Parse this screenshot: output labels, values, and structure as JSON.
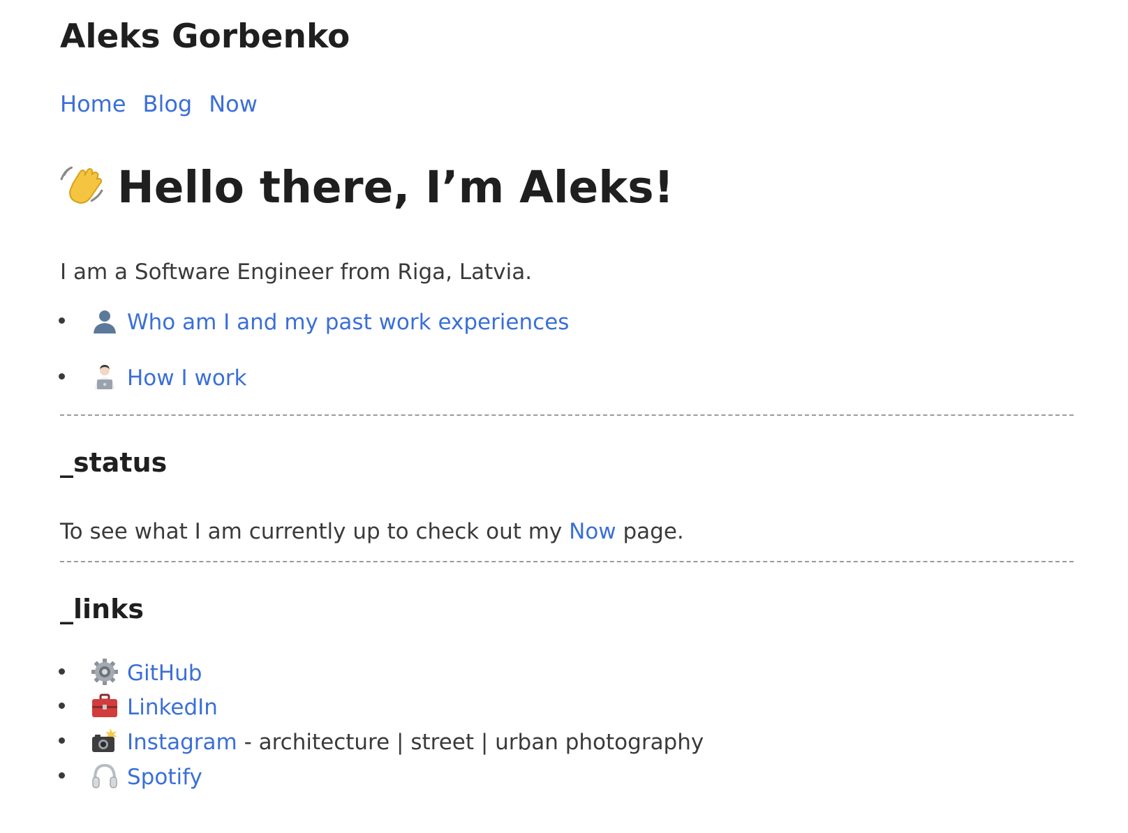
{
  "site": {
    "title": "Aleks Gorbenko"
  },
  "nav": {
    "items": [
      {
        "label": "Home"
      },
      {
        "label": "Blog"
      },
      {
        "label": "Now"
      }
    ]
  },
  "hero": {
    "emoji_icon": "waving-hand-icon",
    "title": "Hello there, I’m Aleks!"
  },
  "intro": {
    "text": "I am a Software Engineer from Riga, Latvia."
  },
  "about_links": [
    {
      "icon": "person-silhouette-icon",
      "label": "Who am I and my past work experiences"
    },
    {
      "icon": "person-laptop-icon",
      "label": "How I work"
    }
  ],
  "status": {
    "heading": "_status",
    "text_before": "To see what I am currently up to check out my ",
    "link_label": "Now",
    "text_after": " page."
  },
  "links": {
    "heading": "_links",
    "items": [
      {
        "icon": "gear-icon",
        "label": "GitHub",
        "suffix": ""
      },
      {
        "icon": "toolbox-icon",
        "label": "LinkedIn",
        "suffix": ""
      },
      {
        "icon": "camera-flash-icon",
        "label": "Instagram",
        "suffix": " - architecture | street | urban photography"
      },
      {
        "icon": "headphones-icon",
        "label": "Spotify",
        "suffix": ""
      }
    ]
  },
  "colors": {
    "link": "#3a6fd8",
    "text": "#3a3a3a",
    "heading": "#1f1f1f"
  }
}
